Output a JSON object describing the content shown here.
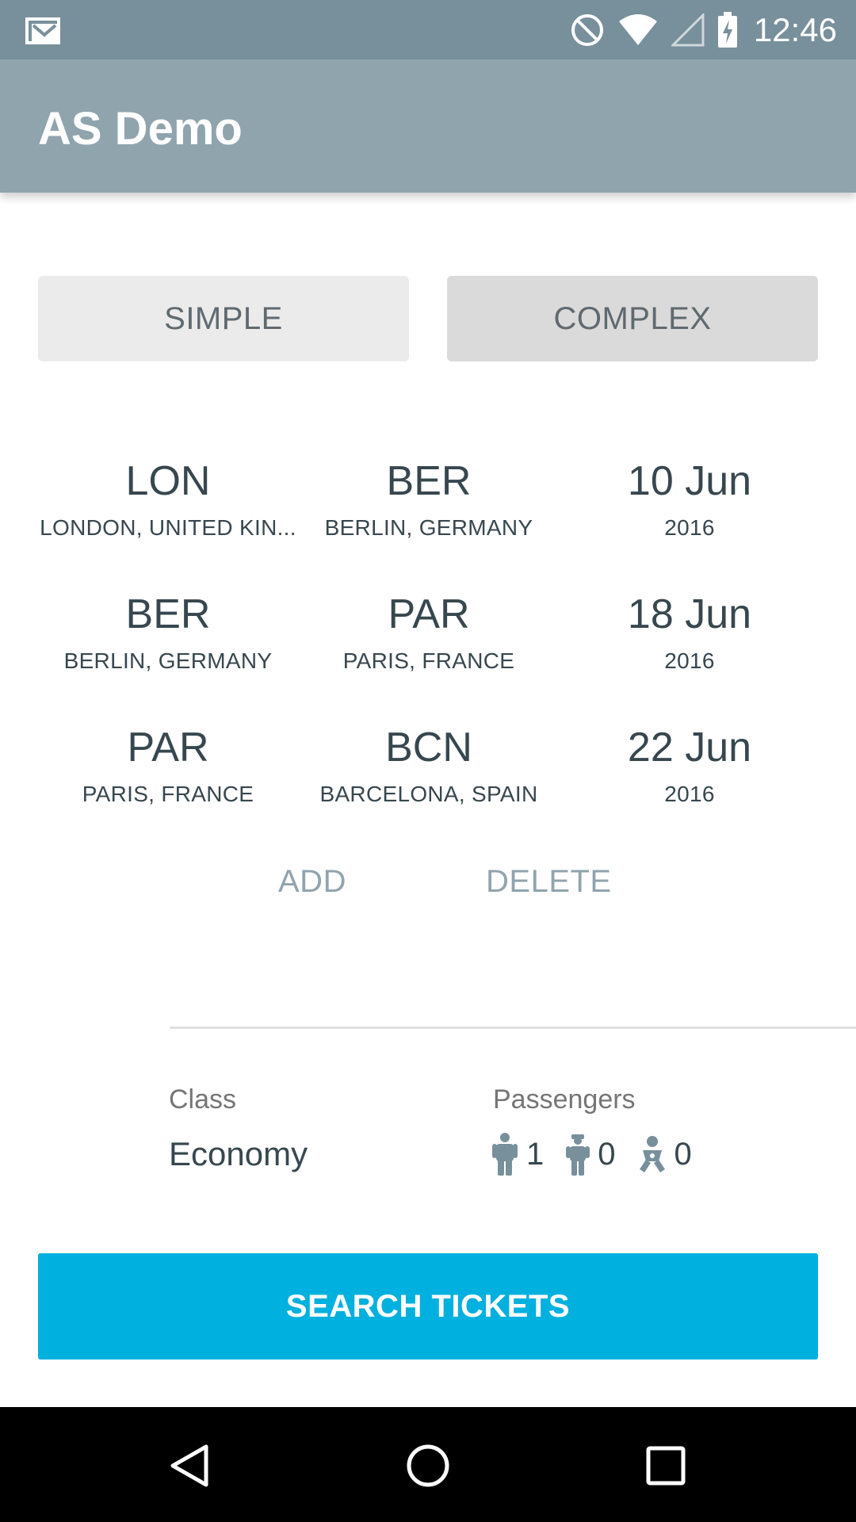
{
  "status_bar": {
    "time": "12:46",
    "icons": [
      "gmail-icon",
      "do-not-disturb-icon",
      "wifi-icon",
      "signal-icon",
      "battery-charging-icon"
    ]
  },
  "app_bar": {
    "title": "AS Demo"
  },
  "mode": {
    "simple_label": "SIMPLE",
    "complex_label": "COMPLEX",
    "selected": "COMPLEX"
  },
  "routes": [
    {
      "from_code": "LON",
      "from_name": "LONDON, UNITED KIN...",
      "to_code": "BER",
      "to_name": "BERLIN, GERMANY",
      "date": "10 Jun",
      "year": "2016"
    },
    {
      "from_code": "BER",
      "from_name": "BERLIN, GERMANY",
      "to_code": "PAR",
      "to_name": "PARIS, FRANCE",
      "date": "18 Jun",
      "year": "2016"
    },
    {
      "from_code": "PAR",
      "from_name": "PARIS, FRANCE",
      "to_code": "BCN",
      "to_name": "BARCELONA, SPAIN",
      "date": "22 Jun",
      "year": "2016"
    }
  ],
  "actions": {
    "add_label": "ADD",
    "delete_label": "DELETE"
  },
  "class": {
    "label": "Class",
    "value": "Economy"
  },
  "passengers": {
    "label": "Passengers",
    "adults": "1",
    "children": "0",
    "infants": "0"
  },
  "search": {
    "label": "SEARCH TICKETS"
  },
  "colors": {
    "status_bar": "#78909c",
    "app_bar": "#90a4ae",
    "accent": "#00b0de",
    "text_primary": "#37474f",
    "text_secondary": "#757575"
  }
}
